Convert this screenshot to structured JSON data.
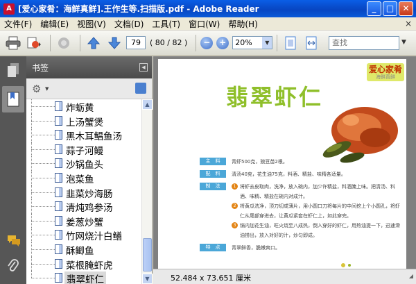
{
  "window": {
    "title": "[爱心家肴：海鲜真鲜].王作生等.扫描版.pdf - Adobe Reader",
    "minimize": "_",
    "maximize": "□",
    "close": "✕"
  },
  "menu": {
    "items": [
      "文件(F)",
      "编辑(E)",
      "视图(V)",
      "文档(D)",
      "工具(T)",
      "窗口(W)",
      "帮助(H)"
    ],
    "close_glyph": "×"
  },
  "toolbar": {
    "page_current": "79",
    "page_total": "( 80 / 82 )",
    "zoom": "20%",
    "search_placeholder": "查找"
  },
  "bookmarks": {
    "header": "书签",
    "items": [
      {
        "label": "炸蛎黄",
        "selected": false
      },
      {
        "label": "上汤蟹煲",
        "selected": false
      },
      {
        "label": "黑木耳鲳鱼汤",
        "selected": false
      },
      {
        "label": "蒜子河鳗",
        "selected": false
      },
      {
        "label": "沙锅鱼头",
        "selected": false
      },
      {
        "label": "泡菜鱼",
        "selected": false
      },
      {
        "label": "韭菜炒海肠",
        "selected": false
      },
      {
        "label": "清炖鸡参汤",
        "selected": false
      },
      {
        "label": "姜葱炒蟹",
        "selected": false
      },
      {
        "label": "竹网烧汁白鳝",
        "selected": false
      },
      {
        "label": "酥鲫鱼",
        "selected": false
      },
      {
        "label": "菜根腌虾虎",
        "selected": false
      },
      {
        "label": "翡翠虾仁",
        "selected": true
      }
    ]
  },
  "document": {
    "brand": "爱心家肴",
    "brand_sub": "海鲜真鲜",
    "dish_title": "翡翠虾仁",
    "sections": [
      {
        "tag": "主　料",
        "text": "青虾500克，豌豆苗2根。"
      },
      {
        "tag": "配　料",
        "text": "清汤40克，花生油75克，料酒、精盐、味精各适量。"
      },
      {
        "tag": "制　法",
        "steps": [
          {
            "num": "1",
            "text": "将虾去皮取肉，洗净，放入碗内，加少许精盐，料酒腌上味。把清汤、料酒、味精、精盐在碗内对成汁。"
          },
          {
            "num": "2",
            "text": "将黄瓜洗净，顶刀切成薄片，用小圆口刀将每片的中间挖上个小圆孔，将虾仁从尾部穿进去，让黄瓜紧套在虾仁上，如此穿完。"
          },
          {
            "num": "3",
            "text": "锅内加花生油，旺火烧至八成热，倒入穿好的虾仁，用热油提一下，迅速滑油捞出，放入对好的汁，炒匀即成。"
          }
        ]
      },
      {
        "tag": "特　点",
        "text": "青翠鲜香，脆嫩爽口。"
      }
    ]
  },
  "status": {
    "dimensions": "52.484 x 73.651 厘米"
  },
  "colors": {
    "title_bar": "#0a5ee6",
    "title_green": "#8fbf2a",
    "tag_blue": "#4ba7d8",
    "step_orange": "#e38414",
    "left_bar": "#565656"
  }
}
